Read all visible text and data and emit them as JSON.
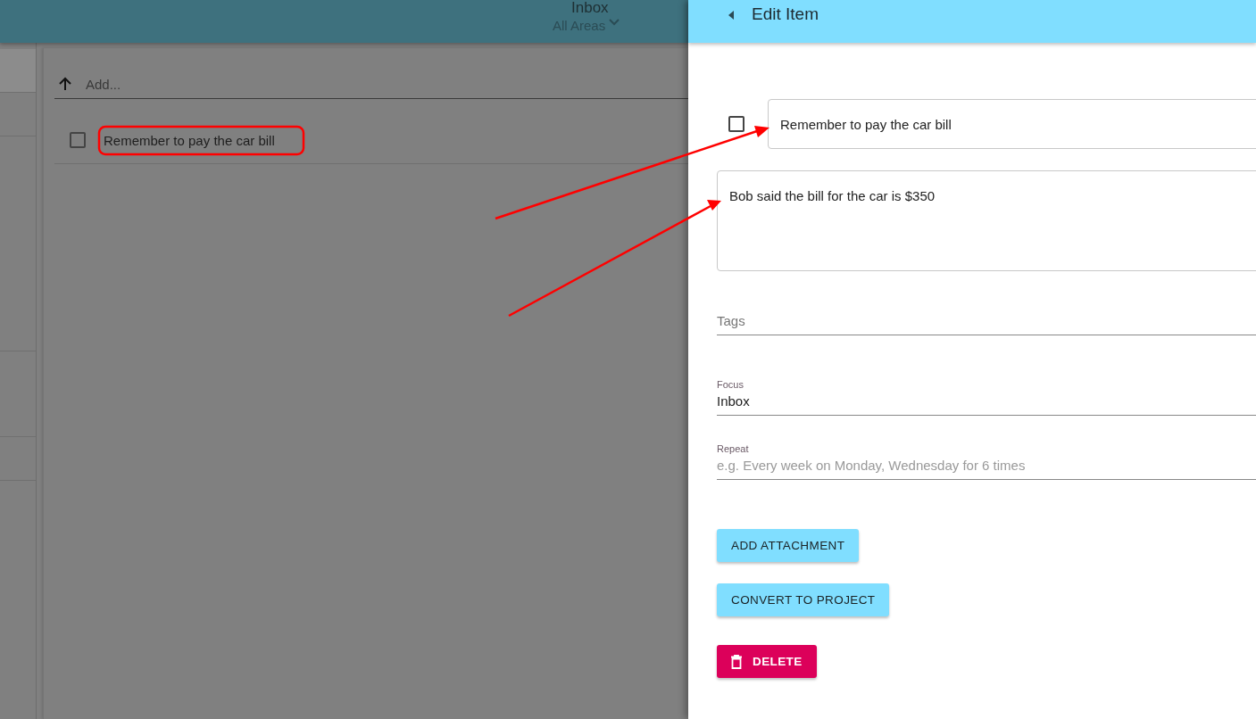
{
  "app_bar": {
    "title": "Inbox",
    "area_selector": "All Areas"
  },
  "add_field": {
    "placeholder": "Add..."
  },
  "tasks": [
    {
      "title": "Remember to pay the car bill",
      "checked": false
    }
  ],
  "drawer": {
    "title": "Edit Item",
    "checked": false,
    "title_value": "Remember to pay the car bill",
    "notes_value": "Bob said the bill for the car is $350",
    "tags": {
      "placeholder": "Tags"
    },
    "focus": {
      "label": "Focus",
      "value": "Inbox"
    },
    "repeat": {
      "label": "Repeat",
      "placeholder": "e.g. Every week on Monday, Wednesday for 6 times"
    },
    "buttons": [
      {
        "label": "ADD ATTACHMENT",
        "kind": "primary"
      },
      {
        "label": "CONVERT TO PROJECT",
        "kind": "primary"
      },
      {
        "label": "DELETE",
        "kind": "danger"
      }
    ]
  }
}
